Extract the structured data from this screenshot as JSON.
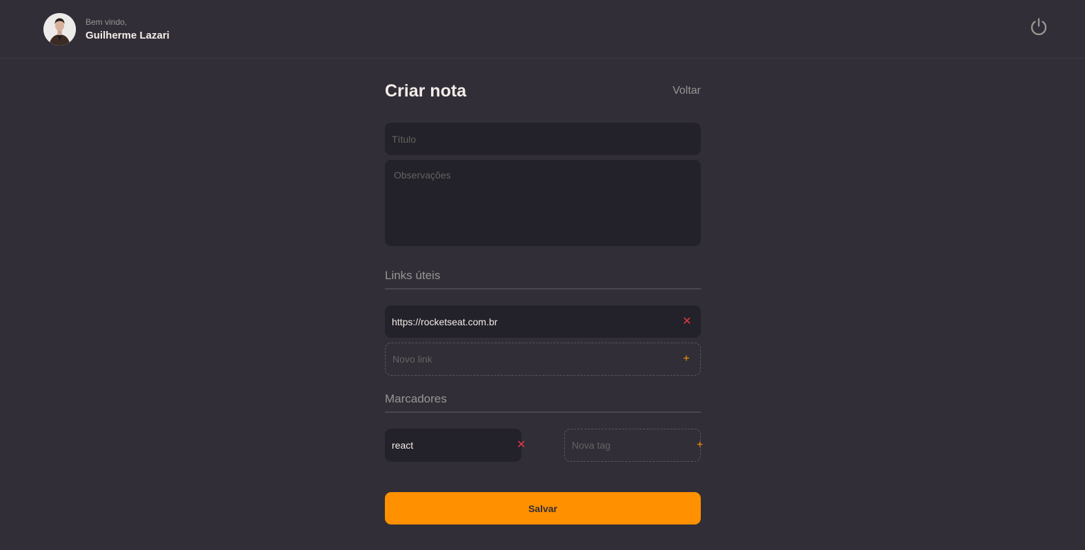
{
  "header": {
    "greeting": "Bem vindo,",
    "user_name": "Guilherme Lazari",
    "avatar_icon": "user-avatar-photo",
    "signout_icon": "power-icon"
  },
  "form": {
    "title": "Criar nota",
    "back_label": "Voltar",
    "title_placeholder": "Título",
    "notes_placeholder": "Observações",
    "links_section": "Links úteis",
    "links": [
      {
        "value": "https://rocketseat.com.br",
        "action_icon": "close-icon"
      }
    ],
    "new_link_placeholder": "Novo link",
    "tags_section": "Marcadores",
    "tags": [
      {
        "value": "react",
        "action_icon": "close-icon"
      }
    ],
    "new_tag_placeholder": "Nova tag",
    "save_label": "Salvar",
    "remove_glyph": "✕",
    "add_glyph": "+"
  },
  "colors": {
    "background": "#312E38",
    "input_background": "#232129",
    "accent": "#FF9000",
    "remove": "#E63946",
    "muted_text": "#999591"
  }
}
